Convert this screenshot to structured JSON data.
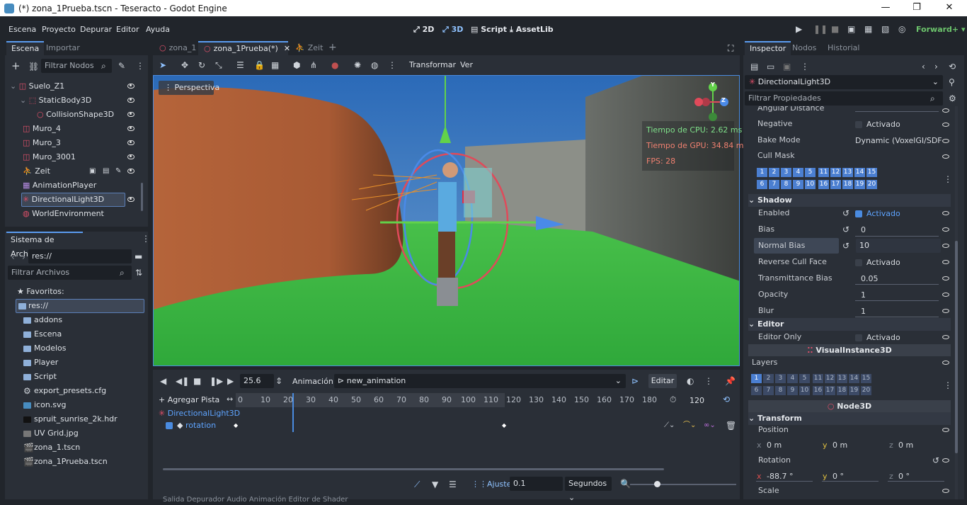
{
  "window": {
    "title": "(*) zona_1Prueba.tscn - Teseracto - Godot Engine",
    "controls": [
      "—",
      "❐",
      "✕"
    ]
  },
  "menu": [
    "Escena",
    "Proyecto",
    "Depurar",
    "Editor",
    "Ayuda"
  ],
  "workspace": {
    "btn_2d": "2D",
    "btn_3d": "3D",
    "btn_script": "Script",
    "btn_assetlib": "AssetLib"
  },
  "renderer": "Forward+",
  "scene_dock": {
    "tabs": [
      "Escena",
      "Importar"
    ],
    "filter_placeholder": "Filtrar Nodos",
    "nodes": [
      "Suelo_Z1",
      "StaticBody3D",
      "CollisionShape3D",
      "Muro_4",
      "Muro_3",
      "Muro_3001",
      "Zeit",
      "AnimationPlayer",
      "DirectionalLight3D",
      "WorldEnvironment"
    ]
  },
  "fs_dock": {
    "title": "Sistema de Archivos",
    "path": "res://",
    "filter_placeholder": "Filtrar Archivos",
    "favorites": "Favoritos:",
    "items": [
      "res://",
      "addons",
      "Escena",
      "Modelos",
      "Player",
      "Script",
      "export_presets.cfg",
      "icon.svg",
      "spruit_sunrise_2k.hdr",
      "UV Grid.jpg",
      "zona_1.tscn",
      "zona_1Prueba.tscn"
    ]
  },
  "scene_tabs": [
    "zona_1",
    "zona_1Prueba(*)",
    "Zeit"
  ],
  "viewport_toolbar": {
    "transform": "Transformar",
    "view": "Ver"
  },
  "viewport": {
    "label": "Perspectiva",
    "cpu": "Tiempo de CPU: 2.62 ms",
    "gpu": "Tiempo de GPU: 34.84 ms",
    "fps": "FPS: 28"
  },
  "animation": {
    "time": "25.6",
    "label": "Animación",
    "name": "new_animation",
    "edit": "Editar",
    "add_track": "Agregar Pista",
    "length": "120",
    "ticks": [
      "0",
      "10",
      "20",
      "30",
      "40",
      "50",
      "60",
      "70",
      "80",
      "90",
      "100",
      "110",
      "120",
      "130",
      "140",
      "150",
      "160",
      "170",
      "180"
    ],
    "track_node": "DirectionalLight3D",
    "track_prop": "rotation",
    "snap_label": "Ajuste:",
    "snap": "0.1",
    "unit": "Segundos",
    "bottom_tabs": "Salida   Depurador   Audio   Animación   Editor de Shader"
  },
  "inspector": {
    "tabs": [
      "Inspector",
      "Nodos",
      "Historial"
    ],
    "node": "DirectionalLight3D",
    "filter_placeholder": "Filtrar Propiedades",
    "angular": "Angular Distance",
    "negative": "Negative",
    "activado": "Activado",
    "bake_mode": "Bake Mode",
    "bake_val": "Dynamic (VoxelGI/SDFGI)",
    "cull_mask": "Cull Mask",
    "shadow": "Shadow",
    "enabled": "Enabled",
    "bias": "Bias",
    "bias_val": "0",
    "normal_bias": "Normal Bias",
    "normal_bias_val": "10",
    "reverse_cull": "Reverse Cull Face",
    "transmittance": "Transmittance Bias",
    "transmittance_val": "0.05",
    "opacity": "Opacity",
    "opacity_val": "1",
    "blur": "Blur",
    "blur_val": "1",
    "editor": "Editor",
    "editor_only": "Editor Only",
    "visual_instance": "VisualInstance3D",
    "layers": "Layers",
    "node3d": "Node3D",
    "transform": "Transform",
    "position": "Position",
    "pos": [
      "0 m",
      "0 m",
      "0 m"
    ],
    "rotation": "Rotation",
    "rot": [
      "-88.7 °",
      "0 °",
      "0 °"
    ],
    "scale": "Scale",
    "axes": [
      "x",
      "y",
      "z"
    ],
    "layer_row1": [
      "1",
      "2",
      "3",
      "4",
      "5",
      "11",
      "12",
      "13",
      "14",
      "15"
    ],
    "layer_row2": [
      "6",
      "7",
      "8",
      "9",
      "10",
      "16",
      "17",
      "18",
      "19",
      "20"
    ]
  }
}
